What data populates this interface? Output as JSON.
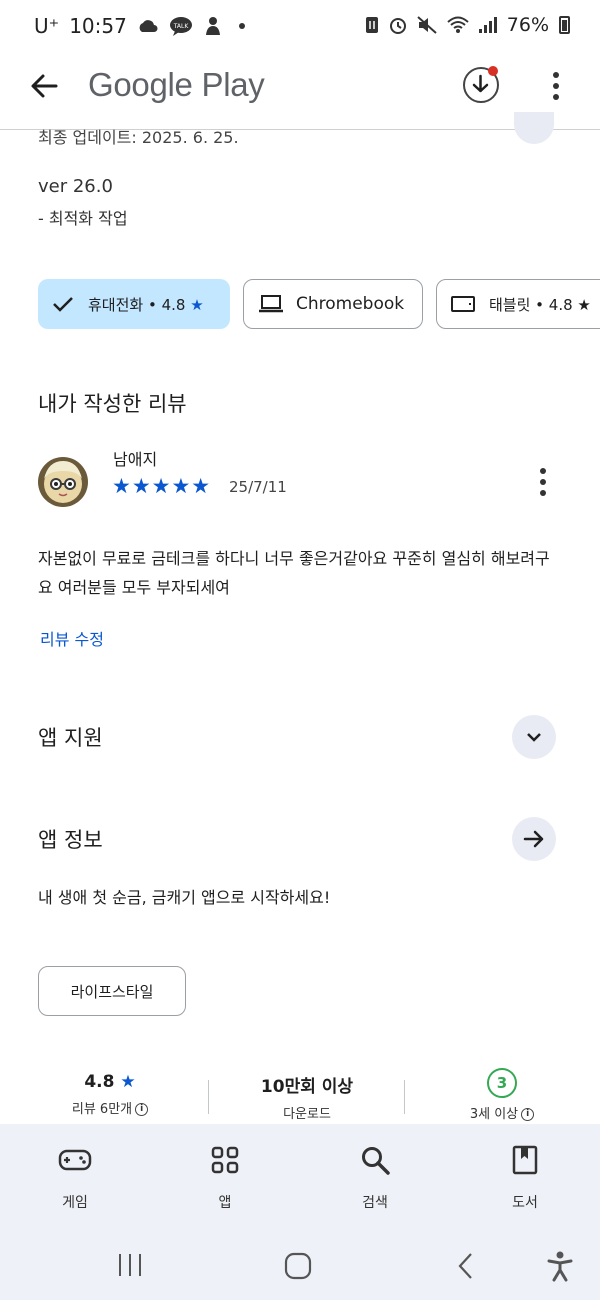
{
  "status_bar": {
    "carrier": "U⁺",
    "time": "10:57",
    "battery": "76%"
  },
  "app_bar": {
    "title": "Google Play",
    "icons": [
      "back-arrow-icon",
      "download-icon",
      "more-vert-icon"
    ]
  },
  "whats_new": {
    "last_updated_partial": "최종 업데이트: 2025. 6. 25.",
    "version": "ver 26.0",
    "notes": "- 최적화 작업"
  },
  "device_chips": [
    {
      "label": "휴대전화 • 4.8",
      "selected": true,
      "icon": "check-icon"
    },
    {
      "label": "Chromebook",
      "selected": false,
      "icon": "laptop-icon"
    },
    {
      "label": "태블릿 • 4.8",
      "selected": false,
      "icon": "tablet-icon"
    }
  ],
  "my_review": {
    "heading": "내가 작성한 리뷰",
    "reviewer": "남애지",
    "rating": 5,
    "stars": "★★★★★",
    "date": "25/7/11",
    "body": "자본없이 무료로 금테크를 하다니 너무 좋은거같아요 꾸준히 열심히 해보려구요 여러분들 모두 부자되세여",
    "edit_label": "리뷰 수정"
  },
  "app_support": {
    "heading": "앱 지원"
  },
  "app_info": {
    "heading": "앱 정보",
    "description": "내 생애 첫 순금, 금캐기 앱으로 시작하세요!",
    "category": "라이프스타일"
  },
  "stats": {
    "rating_value": "4.8",
    "star": "★",
    "rating_label": "리뷰 6만개",
    "downloads_value": "10만회 이상",
    "downloads_label": "다운로드",
    "age_value": "3",
    "age_label": "3세 이상"
  },
  "bottom_nav": [
    {
      "label": "게임",
      "icon": "gamepad-icon"
    },
    {
      "label": "앱",
      "icon": "apps-grid-icon"
    },
    {
      "label": "검색",
      "icon": "search-icon"
    },
    {
      "label": "도서",
      "icon": "book-icon"
    }
  ],
  "colors": {
    "accent": "#0b57d0",
    "chip_selected": "#c2e7ff",
    "nav_bg": "#eef1f7",
    "age_green": "#34a853",
    "badge_red": "#d93025"
  }
}
